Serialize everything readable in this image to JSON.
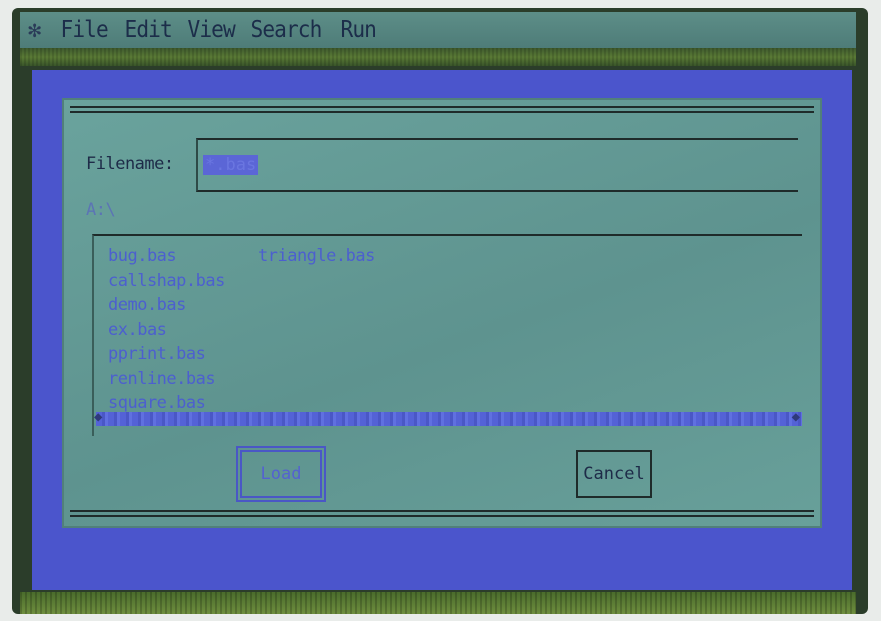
{
  "menubar": {
    "apple_glyph": "✻",
    "items": [
      "File",
      "Edit",
      "View",
      "Search",
      "Run"
    ]
  },
  "dialog": {
    "filename_label": "Filename:",
    "filename_value": "*.bas",
    "path": "A:\\",
    "files_col1": [
      "bug.bas",
      "callshap.bas",
      "demo.bas",
      "ex.bas",
      "pprint.bas",
      "renline.bas",
      "square.bas"
    ],
    "files_col2": [
      "triangle.bas"
    ],
    "load_label": "Load",
    "cancel_label": "Cancel"
  },
  "colors": {
    "desktop": "#4b55cc",
    "dialog": "#6aa39d",
    "menubar": "#5d8e88",
    "text": "#1e2b48",
    "highlight": "#5b66d6"
  }
}
